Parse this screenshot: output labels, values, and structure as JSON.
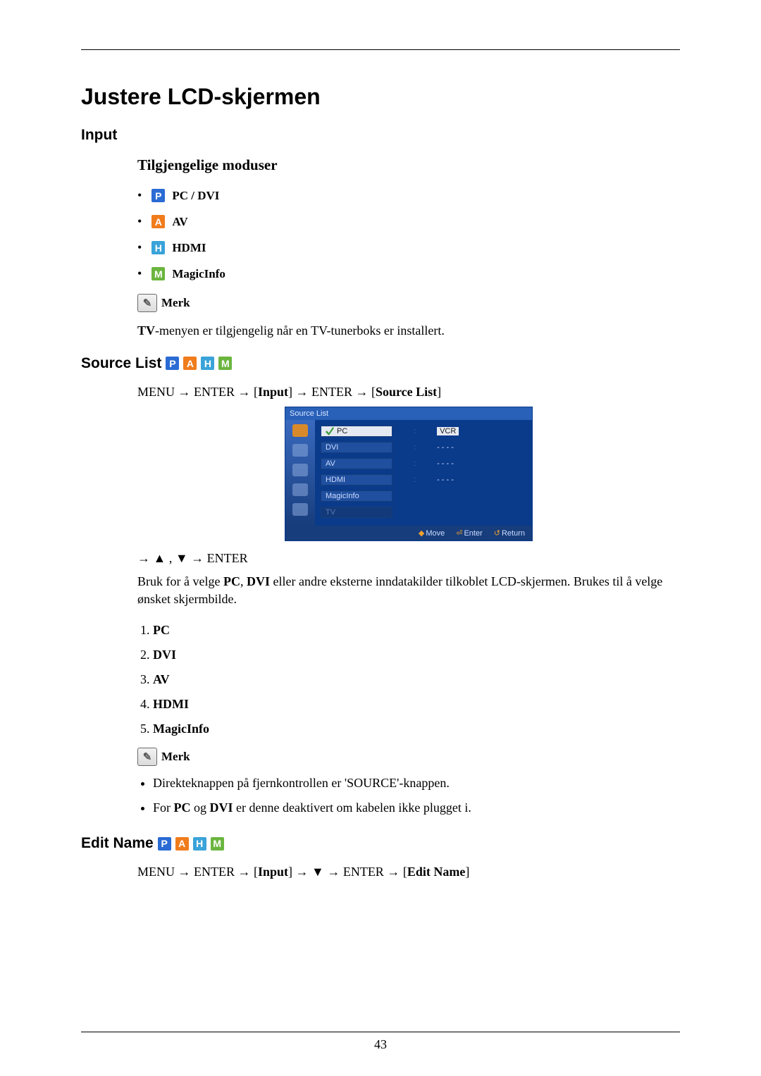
{
  "page_number": "43",
  "main_title": "Justere LCD-skjermen",
  "section_input": "Input",
  "sub_available_modes": "Tilgjengelige moduser",
  "modes": {
    "pc_dvi": "PC / DVI",
    "av": "AV",
    "hdmi": "HDMI",
    "magicinfo": "MagicInfo"
  },
  "note_label": "Merk",
  "tv_note_prefix_bold": "TV",
  "tv_note_rest": "-menyen er tilgjengelig når en TV-tunerboks er installert.",
  "section_source_list": "Source List",
  "source_list_nav": {
    "p1": "MENU → ENTER → [",
    "b1": "Input",
    "p2": "] → ENTER → [",
    "b2": "Source List",
    "p3": "]"
  },
  "osd": {
    "title": "Source List",
    "rows": [
      {
        "label": "PC",
        "value": "VCR",
        "selected": true,
        "check": true
      },
      {
        "label": "DVI",
        "value": "- - - -"
      },
      {
        "label": "AV",
        "value": "- - - -"
      },
      {
        "label": "HDMI",
        "value": "- - - -"
      },
      {
        "label": "MagicInfo",
        "value": ""
      },
      {
        "label": "TV",
        "value": "",
        "disabled": true
      }
    ],
    "footer": {
      "move": "Move",
      "enter": "Enter",
      "return": "Return"
    }
  },
  "arrow_nav": "→ ▲ , ▼ → ENTER",
  "source_desc": {
    "p1": "Bruk for å velge ",
    "b1": "PC",
    "p2": ", ",
    "b2": "DVI",
    "p3": " eller andre eksterne inndatakilder tilkoblet LCD-skjermen. Brukes til å velge ønsket skjermbilde."
  },
  "num_list": [
    "PC",
    "DVI",
    "AV",
    "HDMI",
    "MagicInfo"
  ],
  "note2_label": "Merk",
  "bullets": {
    "b1": "Direkteknappen på fjernkontrollen er 'SOURCE'-knappen.",
    "b2_p1": "For ",
    "b2_b1": "PC",
    "b2_p2": " og ",
    "b2_b2": "DVI",
    "b2_p3": " er denne deaktivert om kabelen ikke plugget i."
  },
  "section_edit_name": "Edit Name",
  "edit_name_nav": {
    "p1": "MENU → ENTER → [",
    "b1": "Input",
    "p2": "] → ▼ → ENTER → [",
    "b2": "Edit Name",
    "p3": "]"
  }
}
